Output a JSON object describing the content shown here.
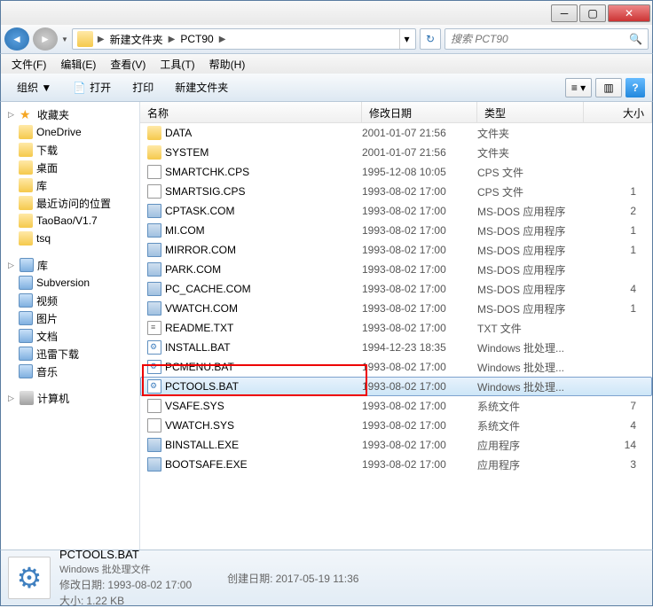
{
  "breadcrumb": [
    "新建文件夹",
    "PCT90"
  ],
  "search_placeholder": "搜索 PCT90",
  "menubar": [
    "文件(F)",
    "编辑(E)",
    "查看(V)",
    "工具(T)",
    "帮助(H)"
  ],
  "toolbar": {
    "organize": "组织 ▼",
    "open": "打开",
    "print": "打印",
    "newfolder": "新建文件夹"
  },
  "sidebar": {
    "favorites": {
      "label": "收藏夹",
      "items": [
        "OneDrive",
        "下载",
        "桌面",
        "库",
        "最近访问的位置",
        "TaoBao/V1.7",
        "tsq"
      ]
    },
    "libraries": {
      "label": "库",
      "items": [
        "Subversion",
        "视频",
        "图片",
        "文档",
        "迅雷下载",
        "音乐"
      ]
    },
    "computer": {
      "label": "计算机"
    }
  },
  "columns": {
    "name": "名称",
    "date": "修改日期",
    "type": "类型",
    "size": "大小"
  },
  "files": [
    {
      "name": "DATA",
      "date": "2001-01-07 21:56",
      "type": "文件夹",
      "size": "",
      "icon": "folder"
    },
    {
      "name": "SYSTEM",
      "date": "2001-01-07 21:56",
      "type": "文件夹",
      "size": "",
      "icon": "folder"
    },
    {
      "name": "SMARTCHK.CPS",
      "date": "1995-12-08 10:05",
      "type": "CPS 文件",
      "size": "",
      "icon": "file"
    },
    {
      "name": "SMARTSIG.CPS",
      "date": "1993-08-02 17:00",
      "type": "CPS 文件",
      "size": "1",
      "icon": "file"
    },
    {
      "name": "CPTASK.COM",
      "date": "1993-08-02 17:00",
      "type": "MS-DOS 应用程序",
      "size": "2",
      "icon": "exe"
    },
    {
      "name": "MI.COM",
      "date": "1993-08-02 17:00",
      "type": "MS-DOS 应用程序",
      "size": "1",
      "icon": "exe"
    },
    {
      "name": "MIRROR.COM",
      "date": "1993-08-02 17:00",
      "type": "MS-DOS 应用程序",
      "size": "1",
      "icon": "exe"
    },
    {
      "name": "PARK.COM",
      "date": "1993-08-02 17:00",
      "type": "MS-DOS 应用程序",
      "size": "",
      "icon": "exe"
    },
    {
      "name": "PC_CACHE.COM",
      "date": "1993-08-02 17:00",
      "type": "MS-DOS 应用程序",
      "size": "4",
      "icon": "exe"
    },
    {
      "name": "VWATCH.COM",
      "date": "1993-08-02 17:00",
      "type": "MS-DOS 应用程序",
      "size": "1",
      "icon": "exe"
    },
    {
      "name": "README.TXT",
      "date": "1993-08-02 17:00",
      "type": "TXT 文件",
      "size": "",
      "icon": "txt"
    },
    {
      "name": "INSTALL.BAT",
      "date": "1994-12-23 18:35",
      "type": "Windows 批处理...",
      "size": "",
      "icon": "bat"
    },
    {
      "name": "PCMENU.BAT",
      "date": "1993-08-02 17:00",
      "type": "Windows 批处理...",
      "size": "",
      "icon": "bat"
    },
    {
      "name": "PCTOOLS.BAT",
      "date": "1993-08-02 17:00",
      "type": "Windows 批处理...",
      "size": "",
      "icon": "bat",
      "selected": true
    },
    {
      "name": "VSAFE.SYS",
      "date": "1993-08-02 17:00",
      "type": "系统文件",
      "size": "7",
      "icon": "file"
    },
    {
      "name": "VWATCH.SYS",
      "date": "1993-08-02 17:00",
      "type": "系统文件",
      "size": "4",
      "icon": "file"
    },
    {
      "name": "BINSTALL.EXE",
      "date": "1993-08-02 17:00",
      "type": "应用程序",
      "size": "14",
      "icon": "exe"
    },
    {
      "name": "BOOTSAFE.EXE",
      "date": "1993-08-02 17:00",
      "type": "应用程序",
      "size": "3",
      "icon": "exe"
    }
  ],
  "details": {
    "filename": "PCTOOLS.BAT",
    "filetype": "Windows 批处理文件",
    "moddate_label": "修改日期:",
    "moddate": "1993-08-02 17:00",
    "size_label": "大小:",
    "size": "1.22 KB",
    "created_label": "创建日期:",
    "created": "2017-05-19 11:36"
  }
}
